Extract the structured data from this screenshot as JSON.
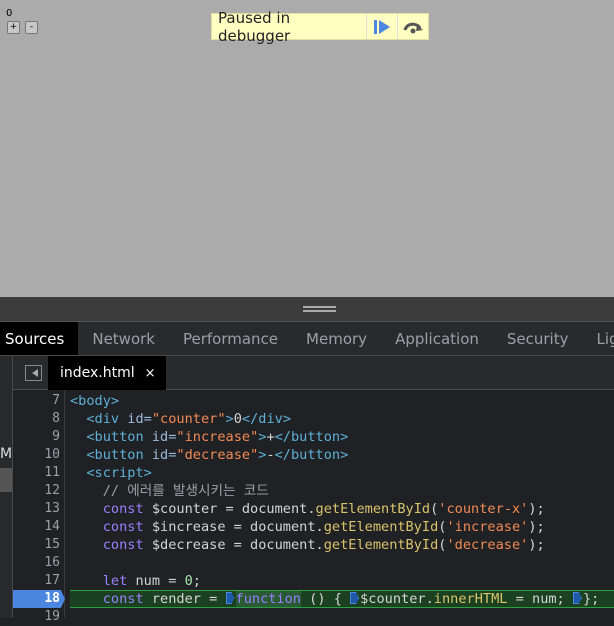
{
  "page": {
    "counter_value": "0",
    "increase_label": "+",
    "decrease_label": "-"
  },
  "overlay": {
    "label": "Paused in debugger",
    "resume_icon": "resume-icon",
    "step_over_icon": "step-over-icon"
  },
  "devtools": {
    "tabs": [
      "Sources",
      "Network",
      "Performance",
      "Memory",
      "Application",
      "Security",
      "Lighthouse"
    ],
    "active_tab": "Sources",
    "file_tab": {
      "name": "index.html",
      "close": "×"
    },
    "left_panel_partial": "M",
    "current_line": 18,
    "lines": [
      {
        "n": "7",
        "tokens": [
          {
            "t": "<body>",
            "c": "tag"
          }
        ]
      },
      {
        "n": "8",
        "tokens": [
          {
            "t": "  <div ",
            "c": "tag"
          },
          {
            "t": "id=",
            "c": "attr"
          },
          {
            "t": "\"counter\"",
            "c": "str"
          },
          {
            "t": ">",
            "c": "tag"
          },
          {
            "t": "0",
            "c": "pl"
          },
          {
            "t": "</div>",
            "c": "tag"
          }
        ]
      },
      {
        "n": "9",
        "tokens": [
          {
            "t": "  <button ",
            "c": "tag"
          },
          {
            "t": "id=",
            "c": "attr"
          },
          {
            "t": "\"increase\"",
            "c": "str"
          },
          {
            "t": ">",
            "c": "tag"
          },
          {
            "t": "+",
            "c": "pl"
          },
          {
            "t": "</button>",
            "c": "tag"
          }
        ]
      },
      {
        "n": "10",
        "tokens": [
          {
            "t": "  <button ",
            "c": "tag"
          },
          {
            "t": "id=",
            "c": "attr"
          },
          {
            "t": "\"decrease\"",
            "c": "str"
          },
          {
            "t": ">",
            "c": "tag"
          },
          {
            "t": "-",
            "c": "pl"
          },
          {
            "t": "</button>",
            "c": "tag"
          }
        ]
      },
      {
        "n": "11",
        "tokens": [
          {
            "t": "  <script>",
            "c": "tag"
          }
        ]
      },
      {
        "n": "12",
        "tokens": [
          {
            "t": "    // 에러를 발생시키는 코드",
            "c": "cm"
          }
        ]
      },
      {
        "n": "13",
        "tokens": [
          {
            "t": "    const ",
            "c": "kw"
          },
          {
            "t": "$counter = document.",
            "c": "pl"
          },
          {
            "t": "getElementById",
            "c": "fn"
          },
          {
            "t": "(",
            "c": "pl"
          },
          {
            "t": "'counter-x'",
            "c": "str"
          },
          {
            "t": ");",
            "c": "pl"
          }
        ]
      },
      {
        "n": "14",
        "tokens": [
          {
            "t": "    const ",
            "c": "kw"
          },
          {
            "t": "$increase = document.",
            "c": "pl"
          },
          {
            "t": "getElementById",
            "c": "fn"
          },
          {
            "t": "(",
            "c": "pl"
          },
          {
            "t": "'increase'",
            "c": "str"
          },
          {
            "t": ");",
            "c": "pl"
          }
        ]
      },
      {
        "n": "15",
        "tokens": [
          {
            "t": "    const ",
            "c": "kw"
          },
          {
            "t": "$decrease = document.",
            "c": "pl"
          },
          {
            "t": "getElementById",
            "c": "fn"
          },
          {
            "t": "(",
            "c": "pl"
          },
          {
            "t": "'decrease'",
            "c": "str"
          },
          {
            "t": ");",
            "c": "pl"
          }
        ]
      },
      {
        "n": "16",
        "tokens": []
      },
      {
        "n": "17",
        "tokens": [
          {
            "t": "    let ",
            "c": "kw"
          },
          {
            "t": "num = ",
            "c": "pl"
          },
          {
            "t": "0",
            "c": "num"
          },
          {
            "t": ";",
            "c": "pl"
          }
        ]
      },
      {
        "n": "18",
        "tokens": [
          {
            "t": "    const ",
            "c": "kw"
          },
          {
            "t": "render = ",
            "c": "pl"
          },
          {
            "t": "",
            "c": "mk"
          },
          {
            "t": "function",
            "c": "fnk"
          },
          {
            "t": " () { ",
            "c": "pl"
          },
          {
            "t": "",
            "c": "mk"
          },
          {
            "t": "$counter.",
            "c": "pl"
          },
          {
            "t": "innerHTML",
            "c": "fn"
          },
          {
            "t": " = num; ",
            "c": "pl"
          },
          {
            "t": "",
            "c": "mk"
          },
          {
            "t": "};",
            "c": "pl"
          }
        ]
      },
      {
        "n": "19",
        "tokens": []
      }
    ]
  }
}
